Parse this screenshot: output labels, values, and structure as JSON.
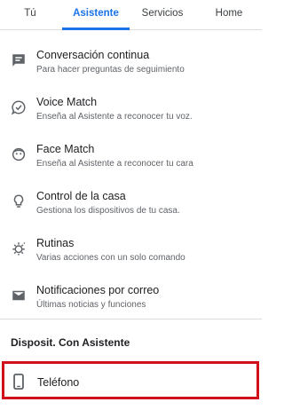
{
  "tabs": [
    {
      "label": "Tú"
    },
    {
      "label": "Asistente",
      "active": true
    },
    {
      "label": "Servicios"
    },
    {
      "label": "Home"
    }
  ],
  "items": [
    {
      "icon": "chat-bubble-icon",
      "title": "Conversación continua",
      "subtitle": "Para hacer preguntas de seguimiento"
    },
    {
      "icon": "voice-match-icon",
      "title": "Voice Match",
      "subtitle": "Enseña al Asistente a reconocer tu voz."
    },
    {
      "icon": "face-icon",
      "title": "Face Match",
      "subtitle": "Enseña al Asistente a reconocer tu cara"
    },
    {
      "icon": "lightbulb-icon",
      "title": "Control de la casa",
      "subtitle": "Gestiona los dispositivos de tu casa."
    },
    {
      "icon": "routine-sun-icon",
      "title": "Rutinas",
      "subtitle": "Varias acciones con un solo comando"
    },
    {
      "icon": "mail-icon",
      "title": "Notificaciones por correo",
      "subtitle": "Últimas noticias y funciones"
    }
  ],
  "section": {
    "title": "Disposit. Con Asistente"
  },
  "device": {
    "icon": "phone-icon",
    "title": "Teléfono"
  },
  "colors": {
    "accent": "#1a73e8",
    "highlight": "#d0111b",
    "icon": "#5f6368"
  }
}
